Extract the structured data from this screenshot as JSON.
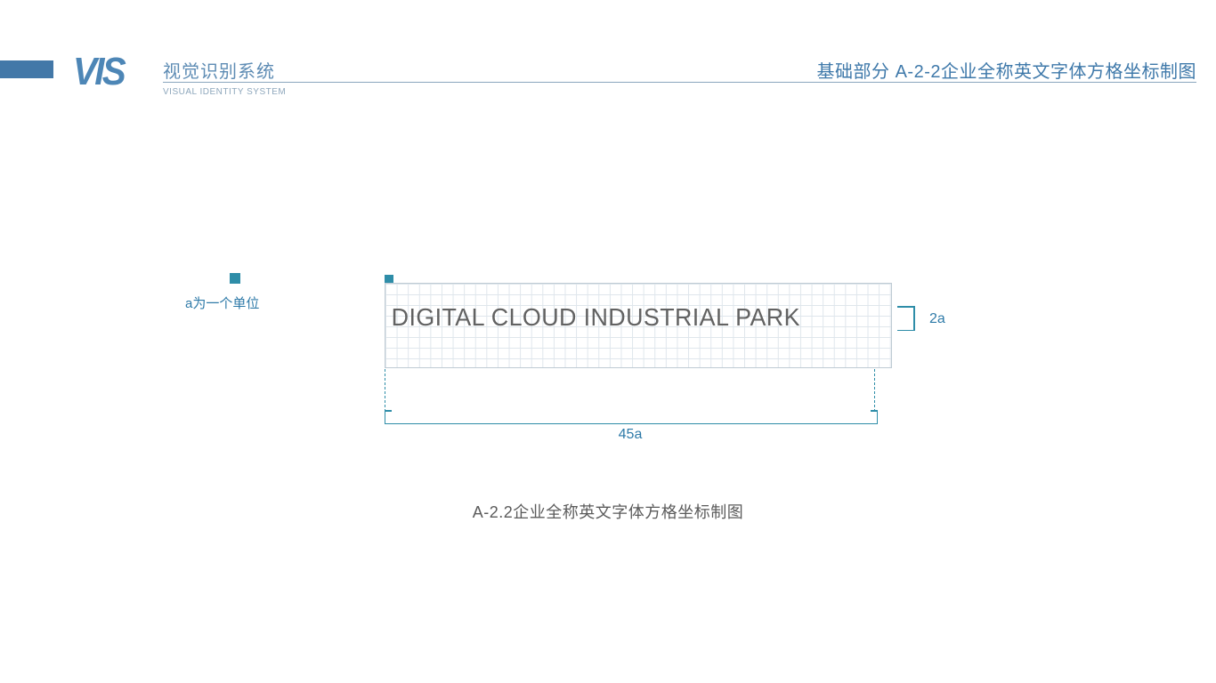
{
  "header": {
    "logo": "VIS",
    "logo_sub": "VISUAL IDENTITY SYSTEM",
    "title_cn": "视觉识别系统",
    "title_right": "基础部分 A-2-2企业全称英文字体方格坐标制图"
  },
  "legend": {
    "unit_note": "a为一个单位"
  },
  "diagram": {
    "text": "DIGITAL CLOUD INDUSTRIAL PARK",
    "width_label": "45a",
    "height_label": "2a",
    "grid_cols": 45,
    "grid_rows": 8
  },
  "caption": "A-2.2企业全称英文字体方格坐标制图",
  "colors": {
    "primary": "#4378a8",
    "accent": "#2e8da8",
    "grid": "#dfe6ec",
    "text_grey": "#626262"
  }
}
